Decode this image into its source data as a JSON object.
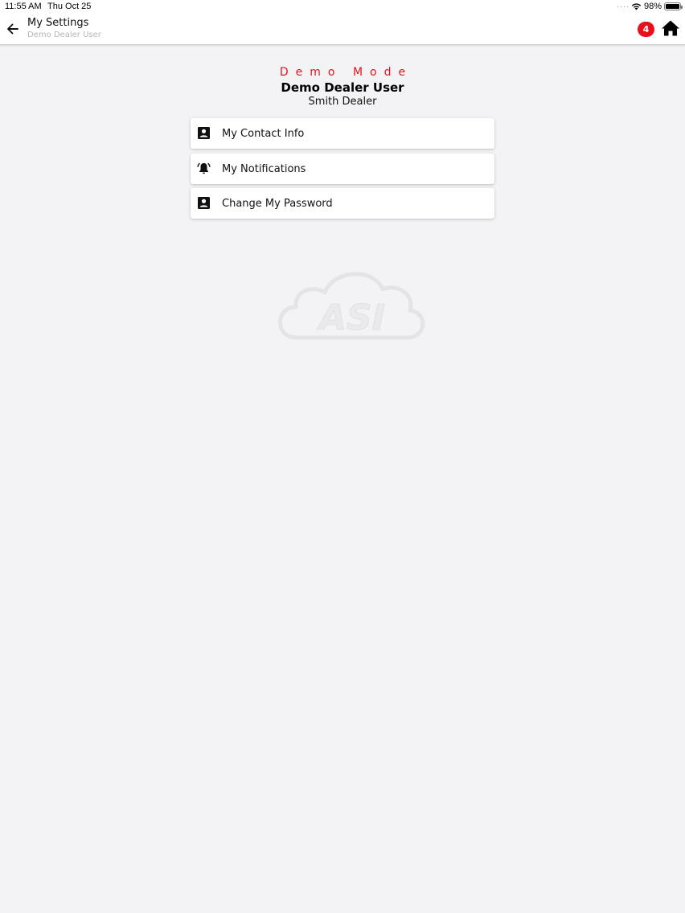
{
  "status_bar": {
    "time": "11:55 AM",
    "date": "Thu Oct 25",
    "dots": "....",
    "battery_percent": "98%",
    "battery_level": 0.98
  },
  "nav": {
    "title": "My Settings",
    "subtitle": "Demo Dealer User",
    "notification_count": "4",
    "back_icon": "arrow-left-icon",
    "home_icon": "home-icon"
  },
  "header": {
    "mode": "Demo Mode",
    "user_name": "Demo Dealer User",
    "dealer_name": "Smith Dealer"
  },
  "menu": {
    "items": [
      {
        "label": "My Contact Info",
        "icon": "contact-card-icon"
      },
      {
        "label": "My Notifications",
        "icon": "bell-ringing-icon"
      },
      {
        "label": "Change My Password",
        "icon": "contact-card-icon"
      }
    ]
  },
  "watermark": {
    "text": "ASI",
    "icon": "cloud-logo-icon"
  },
  "colors": {
    "background": "#f3f2f4",
    "demo_mode_red": "#e0161c",
    "badge_red": "#e8101a"
  }
}
